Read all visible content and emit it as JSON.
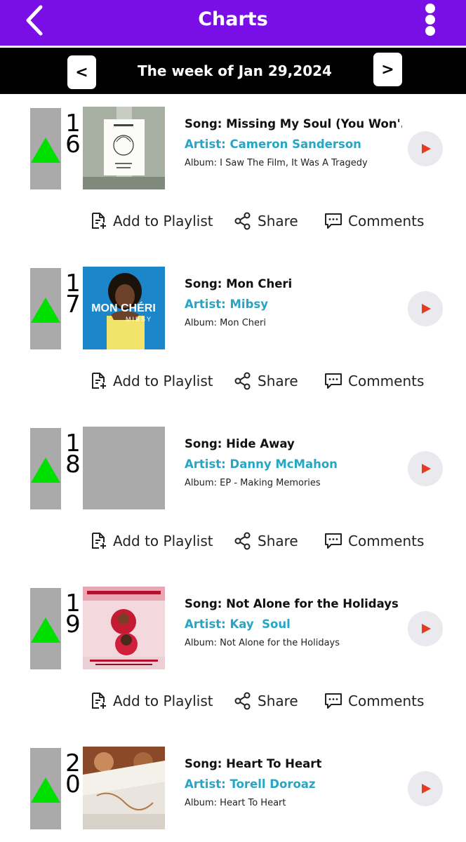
{
  "header": {
    "title": "Charts",
    "back_icon": "chevron-left-icon",
    "menu_icon": "kebab-menu-icon",
    "color": "#7a0ee6"
  },
  "week_nav": {
    "prev_label": "<",
    "next_label": ">",
    "week_label": "The week of Jan 29,2024"
  },
  "actions": {
    "add_label": "Add to Playlist",
    "share_label": "Share",
    "comments_label": "Comments"
  },
  "entries": [
    {
      "rank_d1": "1",
      "rank_d2": "6",
      "trend": "up",
      "song": "Song: Missing My Soul (You Won'...",
      "artist": "Artist: Cameron Sanderson",
      "album": "Album: I Saw The Film, It Was A Tragedy"
    },
    {
      "rank_d1": "1",
      "rank_d2": "7",
      "trend": "up",
      "song": "Song: Mon Cheri",
      "artist": "Artist: Mibsy",
      "album": "Album: Mon Cheri",
      "cover_text": "MON CHÉRI",
      "cover_subtext": "MIBSY"
    },
    {
      "rank_d1": "1",
      "rank_d2": "8",
      "trend": "up",
      "song": "Song: Hide Away",
      "artist": "Artist: Danny McMahon",
      "album": "Album: EP - Making Memories"
    },
    {
      "rank_d1": "1",
      "rank_d2": "9",
      "trend": "up",
      "song": "Song: Not Alone for the Holidays",
      "artist": "Artist: Kay  Soul",
      "album": "Album: Not Alone for the Holidays"
    },
    {
      "rank_d1": "2",
      "rank_d2": "0",
      "trend": "up",
      "song": "Song: Heart To Heart",
      "artist": "Artist: Torell Doroaz",
      "album": "Album: Heart To Heart"
    }
  ]
}
